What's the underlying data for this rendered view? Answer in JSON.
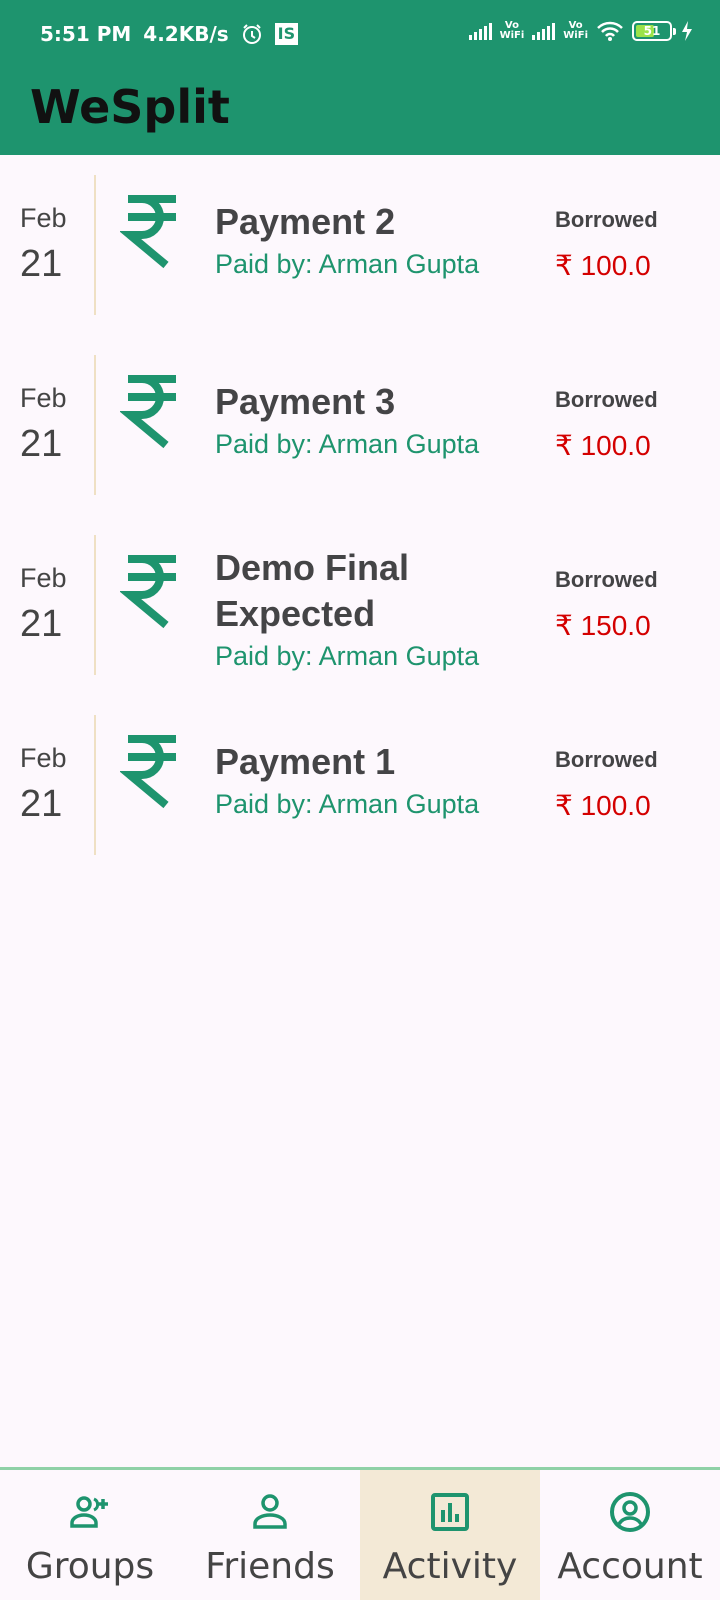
{
  "statusbar": {
    "time": "5:51 PM",
    "speed": "4.2KB/s",
    "badge": "IS",
    "vowifi_top": "Vo",
    "vowifi_bottom": "WiFi",
    "battery": "51"
  },
  "app": {
    "title": "WeSplit",
    "accent": "#1e946e",
    "debt_color": "#d40000"
  },
  "activities": [
    {
      "month": "Feb",
      "day": "21",
      "icon": "rupee-icon",
      "title": "Payment 2",
      "paid_by": "Paid by: Arman Gupta",
      "status": "Borrowed",
      "amount": "₹ 100.0"
    },
    {
      "month": "Feb",
      "day": "21",
      "icon": "rupee-icon",
      "title": "Payment 3",
      "paid_by": "Paid by: Arman Gupta",
      "status": "Borrowed",
      "amount": "₹ 100.0"
    },
    {
      "month": "Feb",
      "day": "21",
      "icon": "rupee-icon",
      "title": "Demo Final Expected",
      "paid_by": "Paid by: Arman Gupta",
      "status": "Borrowed",
      "amount": "₹ 150.0"
    },
    {
      "month": "Feb",
      "day": "21",
      "icon": "rupee-icon",
      "title": "Payment 1",
      "paid_by": "Paid by: Arman Gupta",
      "status": "Borrowed",
      "amount": "₹ 100.0"
    }
  ],
  "nav": {
    "items": [
      {
        "label": "Groups",
        "icon": "group-add-icon"
      },
      {
        "label": "Friends",
        "icon": "person-icon"
      },
      {
        "label": "Activity",
        "icon": "bar-chart-icon",
        "active": true
      },
      {
        "label": "Account",
        "icon": "account-circle-icon"
      }
    ]
  }
}
